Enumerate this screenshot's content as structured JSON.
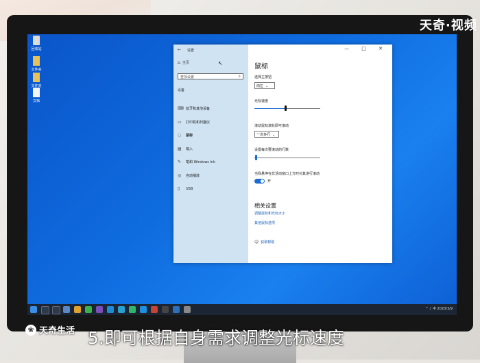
{
  "overlay": {
    "brand_top": "天奇·视频",
    "watermark": "天奇生活",
    "caption": "5.即可根据自身需求调整光标速度"
  },
  "desktop": {
    "icons": [
      {
        "label": "回收站",
        "icon": "recycle-bin-icon",
        "color": "#e8e8e8"
      },
      {
        "label": "文件夹",
        "icon": "folder-icon",
        "color": "#e7c15c"
      },
      {
        "label": "文件夹",
        "icon": "folder-icon",
        "color": "#e7c15c"
      },
      {
        "label": "文档",
        "icon": "document-icon",
        "color": "#f4f4f4"
      }
    ]
  },
  "settings_window": {
    "title": "设置",
    "back": "←",
    "controls": "— □ ✕",
    "home": "主页",
    "search_placeholder": "查找设置",
    "section": "设备",
    "nav": [
      {
        "label": "蓝牙和其他设备",
        "icon": "bluetooth-icon"
      },
      {
        "label": "打印机和扫描仪",
        "icon": "printer-icon"
      },
      {
        "label": "鼠标",
        "icon": "mouse-icon",
        "active": true
      },
      {
        "label": "输入",
        "icon": "keyboard-icon"
      },
      {
        "label": "笔和 Windows Ink",
        "icon": "pen-icon"
      },
      {
        "label": "自动播放",
        "icon": "autoplay-icon"
      },
      {
        "label": "USB",
        "icon": "usb-icon"
      }
    ],
    "page_title": "鼠标",
    "primary_button_label": "选择主按钮",
    "primary_button_value": "向左",
    "cursor_speed_label": "光标速度",
    "cursor_speed_value": 0.47,
    "wheel_label": "滚动鼠标滚轮即可滚动",
    "wheel_value": "一次多行",
    "lines_label": "设置每次要滚动的行数",
    "lines_value": 0.03,
    "inactive_scroll_label": "当我悬停在非活动窗口上方时对其进行滚动",
    "toggle_state": "开",
    "related_title": "相关设置",
    "related_links": [
      "调整鼠标和光标大小",
      "其他鼠标选项"
    ],
    "help": "获取帮助"
  },
  "taskbar": {
    "tray_text": "^ ♪ 中 2020/3/9",
    "accent": "#1b2533"
  },
  "colors": {
    "desktop": "#0f6de0",
    "accent": "#1c6dd0"
  }
}
